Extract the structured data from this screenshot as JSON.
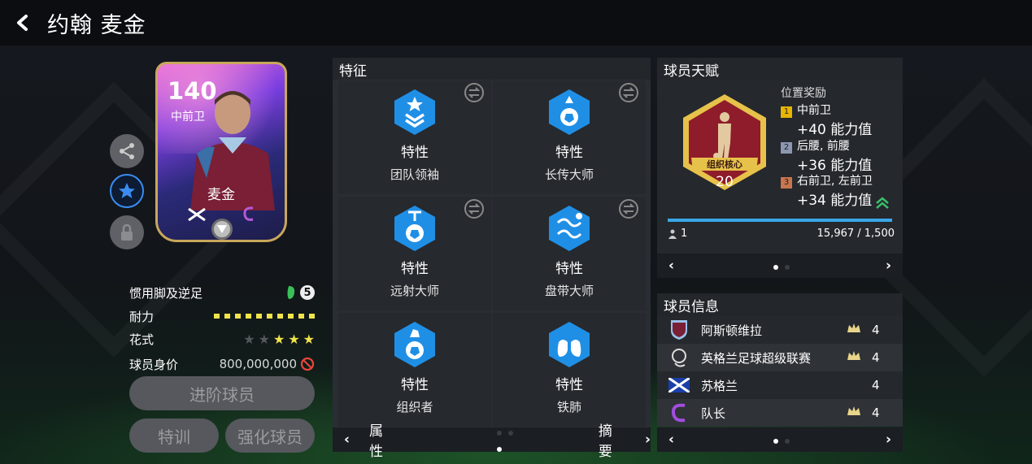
{
  "header": {
    "title": "约翰 麦金"
  },
  "card": {
    "rating": "140",
    "position": "中前卫",
    "name": "麦金"
  },
  "stats": {
    "weak_foot_label": "惯用脚及逆足",
    "weak_foot_value": "5",
    "stamina_label": "耐力",
    "stamina_segments": 10,
    "skill_label": "花式",
    "skill_stars_filled": 3,
    "skill_stars_total": 5,
    "value_label": "球员身价",
    "value": "800,000,000"
  },
  "buttons": {
    "advance": "进阶球员",
    "train": "特训",
    "upgrade": "强化球员"
  },
  "traits": {
    "title": "特征",
    "items": [
      {
        "kind": "特性",
        "name": "团队领袖"
      },
      {
        "kind": "特性",
        "name": "长传大师"
      },
      {
        "kind": "特性",
        "name": "远射大师"
      },
      {
        "kind": "特性",
        "name": "盘带大师"
      },
      {
        "kind": "特性",
        "name": "组织者"
      },
      {
        "kind": "特性",
        "name": "铁肺"
      }
    ],
    "pager_left": "属性",
    "pager_right": "摘要"
  },
  "talent": {
    "title": "球员天赋",
    "badge_label": "组织核心",
    "badge_level": "20",
    "bonus_title": "位置奖励",
    "bonuses": [
      {
        "rank": "1",
        "positions": "中前卫",
        "value": "+40 能力值",
        "color": "#e7b400"
      },
      {
        "rank": "2",
        "positions": "后腰, 前腰",
        "value": "+36 能力值",
        "color": "#8c96b0"
      },
      {
        "rank": "3",
        "positions": "右前卫, 左前卫",
        "value": "+34 能力值",
        "color": "#c9754e"
      }
    ],
    "progress_fraction": 1.0,
    "count": "1",
    "xp": "15,967 / 1,500"
  },
  "info": {
    "title": "球员信息",
    "rows": [
      {
        "name": "阿斯顿维拉",
        "count": "4",
        "crown": true
      },
      {
        "name": "英格兰足球超级联赛",
        "count": "4",
        "crown": true
      },
      {
        "name": "苏格兰",
        "count": "4",
        "crown": false
      },
      {
        "name": "队长",
        "count": "4",
        "crown": true
      }
    ]
  },
  "colors": {
    "accent_blue": "#1f8fe6",
    "gold": "#e7c24a",
    "talent_red": "#8e1c2a",
    "progress": "#3aa7e6"
  }
}
